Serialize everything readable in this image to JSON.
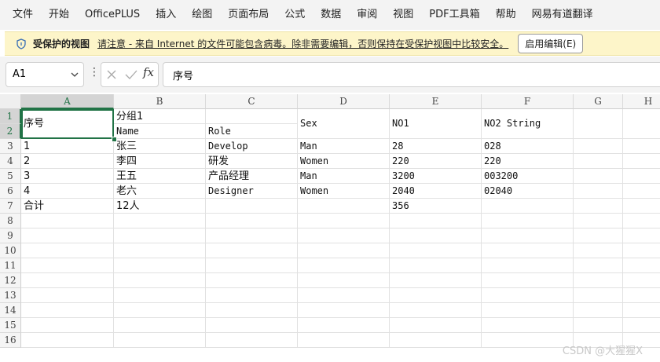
{
  "menu": [
    "文件",
    "开始",
    "OfficePLUS",
    "插入",
    "绘图",
    "页面布局",
    "公式",
    "数据",
    "审阅",
    "视图",
    "PDF工具箱",
    "帮助",
    "网易有道翻译"
  ],
  "protected_view": {
    "title": "受保护的视图",
    "message": "请注意 - 来自 Internet 的文件可能包含病毒。除非需要编辑，否则保持在受保护视图中比较安全。",
    "enable_button": "启用编辑(E)"
  },
  "formula_bar": {
    "name_box": "A1",
    "formula": "序号"
  },
  "grid": {
    "columns": [
      "A",
      "B",
      "C",
      "D",
      "E",
      "F",
      "G",
      "H"
    ],
    "rows": [
      "1",
      "2",
      "3",
      "4",
      "5",
      "6",
      "7",
      "8",
      "9",
      "10",
      "11",
      "12",
      "13",
      "14",
      "15",
      "16"
    ],
    "selected_cell": "A1",
    "header": {
      "a": "序号",
      "group": "分组1",
      "name": "Name",
      "role": "Role",
      "sex": "Sex",
      "no1": "NO1",
      "no2": "NO2 String"
    },
    "data_rows": [
      [
        "1",
        "张三",
        "Develop",
        "Man",
        "28",
        "028"
      ],
      [
        "2",
        "李四",
        "研发",
        "Women",
        "220",
        "220"
      ],
      [
        "3",
        "王五",
        "产品经理",
        "Man",
        "3200",
        "003200"
      ],
      [
        "4",
        "老六",
        "Designer",
        "Women",
        "2040",
        "02040"
      ]
    ],
    "total_row": [
      "合计",
      "12人",
      "",
      "",
      "356",
      ""
    ]
  },
  "watermark": "CSDN @大猩猩X"
}
